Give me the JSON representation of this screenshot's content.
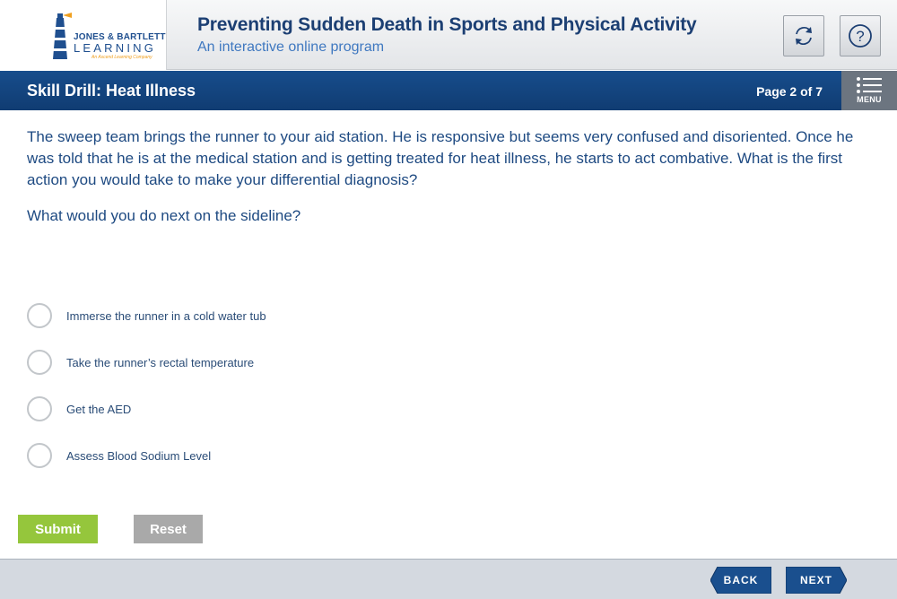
{
  "header": {
    "logo": {
      "line1": "JONES & BARTLETT",
      "line2": "LEARNING",
      "line3": "An Ascend Learning Company"
    },
    "title": "Preventing Sudden Death in Sports and Physical Activity",
    "subtitle": "An interactive online program",
    "refresh_icon": "refresh-icon",
    "help_icon": "question-mark-icon"
  },
  "titlebar": {
    "title": "Skill Drill: Heat Illness",
    "page_indicator": "Page 2 of 7",
    "menu_label": "MENU"
  },
  "content": {
    "question": "The sweep team brings the runner to your aid station. He is responsive but seems very confused and disoriented. Once he was told that he is at the medical station and is getting treated for heat illness, he starts to act combative. What is the first action you would take to make your differential diagnosis?",
    "prompt": "What would you do next on the sideline?",
    "options": [
      {
        "label": "Immerse the runner in a cold water tub"
      },
      {
        "label": "Take the runner’s rectal temperature"
      },
      {
        "label": "Get the AED"
      },
      {
        "label": "Assess Blood Sodium Level"
      }
    ],
    "submit_label": "Submit",
    "reset_label": "Reset"
  },
  "footer": {
    "back_label": "BACK",
    "next_label": "NEXT"
  },
  "colors": {
    "brand_blue": "#174d8c",
    "submit_green": "#95c63c",
    "reset_gray": "#a9a9a9",
    "text_blue": "#1e4a82"
  }
}
